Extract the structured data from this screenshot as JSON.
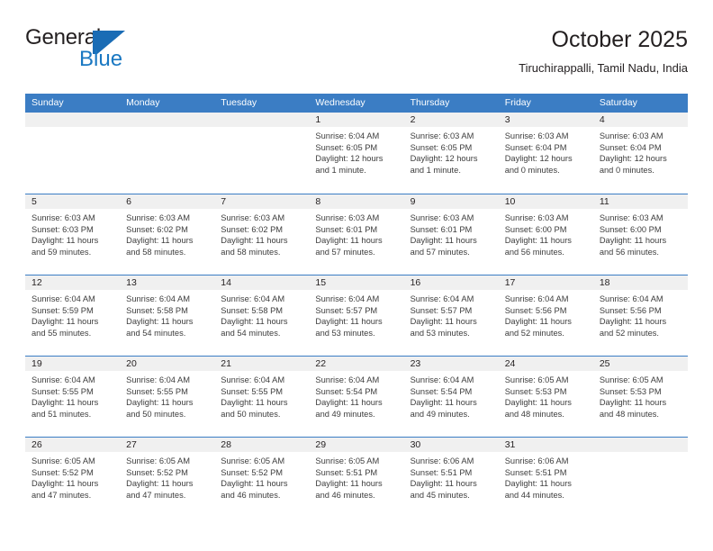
{
  "brand": {
    "line1": "General",
    "line2": "Blue",
    "mark_icon": "triangle-flag-icon",
    "colors": {
      "dark": "#231f20",
      "blue": "#1a78c2"
    }
  },
  "header": {
    "title": "October 2025",
    "subtitle": "Tiruchirappalli, Tamil Nadu, India"
  },
  "theme": {
    "header_blue": "#3b7dc4",
    "day_band_gray": "#f0f0f0",
    "text": "#231f20"
  },
  "calendar": {
    "weekday_headers": [
      "Sunday",
      "Monday",
      "Tuesday",
      "Wednesday",
      "Thursday",
      "Friday",
      "Saturday"
    ],
    "weeks": [
      [
        {
          "day": "",
          "lines": []
        },
        {
          "day": "",
          "lines": []
        },
        {
          "day": "",
          "lines": []
        },
        {
          "day": "1",
          "lines": [
            "Sunrise: 6:04 AM",
            "Sunset: 6:05 PM",
            "Daylight: 12 hours",
            "and 1 minute."
          ]
        },
        {
          "day": "2",
          "lines": [
            "Sunrise: 6:03 AM",
            "Sunset: 6:05 PM",
            "Daylight: 12 hours",
            "and 1 minute."
          ]
        },
        {
          "day": "3",
          "lines": [
            "Sunrise: 6:03 AM",
            "Sunset: 6:04 PM",
            "Daylight: 12 hours",
            "and 0 minutes."
          ]
        },
        {
          "day": "4",
          "lines": [
            "Sunrise: 6:03 AM",
            "Sunset: 6:04 PM",
            "Daylight: 12 hours",
            "and 0 minutes."
          ]
        }
      ],
      [
        {
          "day": "5",
          "lines": [
            "Sunrise: 6:03 AM",
            "Sunset: 6:03 PM",
            "Daylight: 11 hours",
            "and 59 minutes."
          ]
        },
        {
          "day": "6",
          "lines": [
            "Sunrise: 6:03 AM",
            "Sunset: 6:02 PM",
            "Daylight: 11 hours",
            "and 58 minutes."
          ]
        },
        {
          "day": "7",
          "lines": [
            "Sunrise: 6:03 AM",
            "Sunset: 6:02 PM",
            "Daylight: 11 hours",
            "and 58 minutes."
          ]
        },
        {
          "day": "8",
          "lines": [
            "Sunrise: 6:03 AM",
            "Sunset: 6:01 PM",
            "Daylight: 11 hours",
            "and 57 minutes."
          ]
        },
        {
          "day": "9",
          "lines": [
            "Sunrise: 6:03 AM",
            "Sunset: 6:01 PM",
            "Daylight: 11 hours",
            "and 57 minutes."
          ]
        },
        {
          "day": "10",
          "lines": [
            "Sunrise: 6:03 AM",
            "Sunset: 6:00 PM",
            "Daylight: 11 hours",
            "and 56 minutes."
          ]
        },
        {
          "day": "11",
          "lines": [
            "Sunrise: 6:03 AM",
            "Sunset: 6:00 PM",
            "Daylight: 11 hours",
            "and 56 minutes."
          ]
        }
      ],
      [
        {
          "day": "12",
          "lines": [
            "Sunrise: 6:04 AM",
            "Sunset: 5:59 PM",
            "Daylight: 11 hours",
            "and 55 minutes."
          ]
        },
        {
          "day": "13",
          "lines": [
            "Sunrise: 6:04 AM",
            "Sunset: 5:58 PM",
            "Daylight: 11 hours",
            "and 54 minutes."
          ]
        },
        {
          "day": "14",
          "lines": [
            "Sunrise: 6:04 AM",
            "Sunset: 5:58 PM",
            "Daylight: 11 hours",
            "and 54 minutes."
          ]
        },
        {
          "day": "15",
          "lines": [
            "Sunrise: 6:04 AM",
            "Sunset: 5:57 PM",
            "Daylight: 11 hours",
            "and 53 minutes."
          ]
        },
        {
          "day": "16",
          "lines": [
            "Sunrise: 6:04 AM",
            "Sunset: 5:57 PM",
            "Daylight: 11 hours",
            "and 53 minutes."
          ]
        },
        {
          "day": "17",
          "lines": [
            "Sunrise: 6:04 AM",
            "Sunset: 5:56 PM",
            "Daylight: 11 hours",
            "and 52 minutes."
          ]
        },
        {
          "day": "18",
          "lines": [
            "Sunrise: 6:04 AM",
            "Sunset: 5:56 PM",
            "Daylight: 11 hours",
            "and 52 minutes."
          ]
        }
      ],
      [
        {
          "day": "19",
          "lines": [
            "Sunrise: 6:04 AM",
            "Sunset: 5:55 PM",
            "Daylight: 11 hours",
            "and 51 minutes."
          ]
        },
        {
          "day": "20",
          "lines": [
            "Sunrise: 6:04 AM",
            "Sunset: 5:55 PM",
            "Daylight: 11 hours",
            "and 50 minutes."
          ]
        },
        {
          "day": "21",
          "lines": [
            "Sunrise: 6:04 AM",
            "Sunset: 5:55 PM",
            "Daylight: 11 hours",
            "and 50 minutes."
          ]
        },
        {
          "day": "22",
          "lines": [
            "Sunrise: 6:04 AM",
            "Sunset: 5:54 PM",
            "Daylight: 11 hours",
            "and 49 minutes."
          ]
        },
        {
          "day": "23",
          "lines": [
            "Sunrise: 6:04 AM",
            "Sunset: 5:54 PM",
            "Daylight: 11 hours",
            "and 49 minutes."
          ]
        },
        {
          "day": "24",
          "lines": [
            "Sunrise: 6:05 AM",
            "Sunset: 5:53 PM",
            "Daylight: 11 hours",
            "and 48 minutes."
          ]
        },
        {
          "day": "25",
          "lines": [
            "Sunrise: 6:05 AM",
            "Sunset: 5:53 PM",
            "Daylight: 11 hours",
            "and 48 minutes."
          ]
        }
      ],
      [
        {
          "day": "26",
          "lines": [
            "Sunrise: 6:05 AM",
            "Sunset: 5:52 PM",
            "Daylight: 11 hours",
            "and 47 minutes."
          ]
        },
        {
          "day": "27",
          "lines": [
            "Sunrise: 6:05 AM",
            "Sunset: 5:52 PM",
            "Daylight: 11 hours",
            "and 47 minutes."
          ]
        },
        {
          "day": "28",
          "lines": [
            "Sunrise: 6:05 AM",
            "Sunset: 5:52 PM",
            "Daylight: 11 hours",
            "and 46 minutes."
          ]
        },
        {
          "day": "29",
          "lines": [
            "Sunrise: 6:05 AM",
            "Sunset: 5:51 PM",
            "Daylight: 11 hours",
            "and 46 minutes."
          ]
        },
        {
          "day": "30",
          "lines": [
            "Sunrise: 6:06 AM",
            "Sunset: 5:51 PM",
            "Daylight: 11 hours",
            "and 45 minutes."
          ]
        },
        {
          "day": "31",
          "lines": [
            "Sunrise: 6:06 AM",
            "Sunset: 5:51 PM",
            "Daylight: 11 hours",
            "and 44 minutes."
          ]
        },
        {
          "day": "",
          "lines": []
        }
      ]
    ]
  }
}
